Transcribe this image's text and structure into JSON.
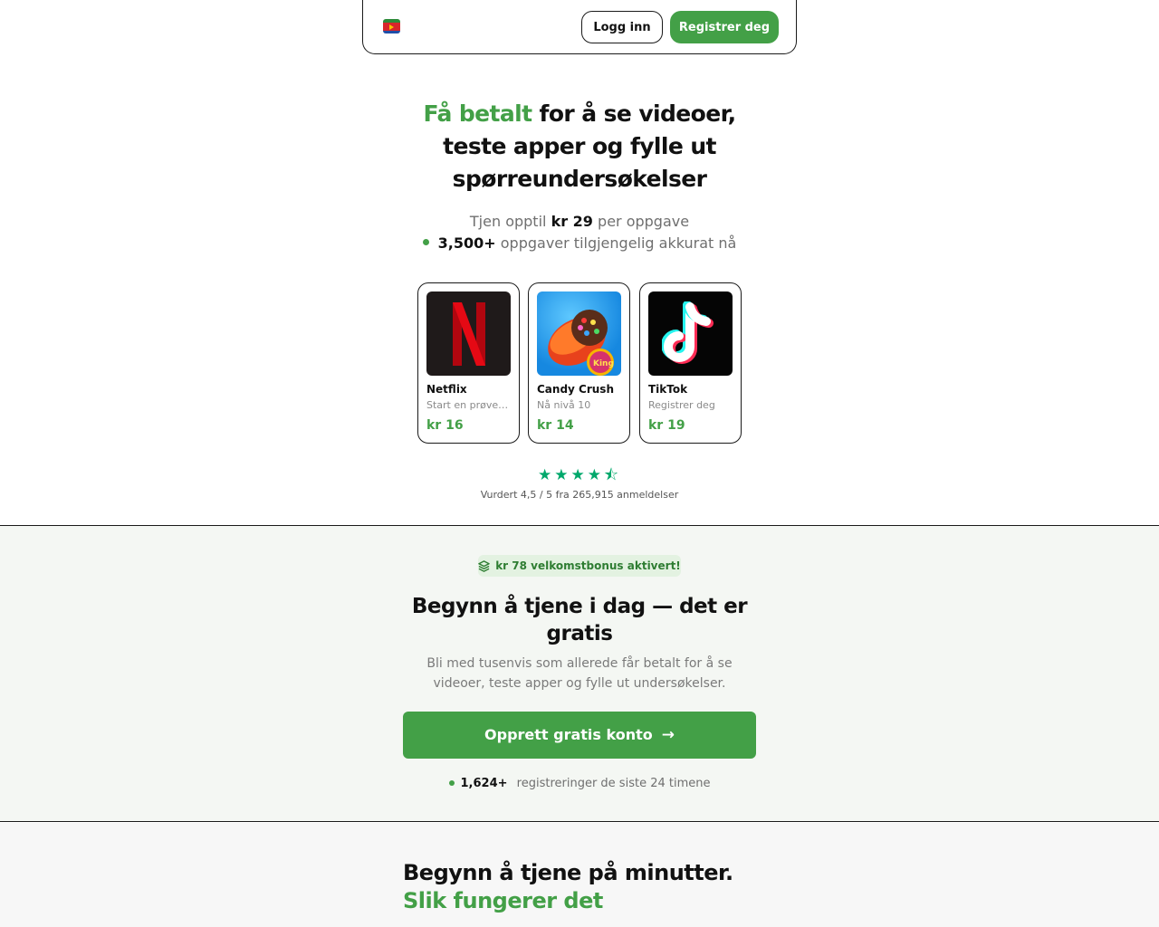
{
  "header": {
    "login_label": "Logg inn",
    "register_label": "Registrer deg"
  },
  "hero": {
    "title_highlight": "Få betalt",
    "title_rest": "for å se videoer, teste apper og fylle ut spørreundersøkelser",
    "earn_prefix": "Tjen opptil",
    "earn_amount": "kr 29",
    "earn_suffix": "per oppgave",
    "tasks_count": "3,500+",
    "tasks_suffix": "oppgaver tilgjengelig akkurat nå"
  },
  "tasks": [
    {
      "name": "Netflix",
      "desc": "Start en prøveperiode",
      "price": "kr 16",
      "icon": "netflix-logo"
    },
    {
      "name": "Candy Crush",
      "desc": "Nå nivå 10",
      "price": "kr 14",
      "icon": "candy-crush-logo"
    },
    {
      "name": "TikTok",
      "desc": "Registrer deg",
      "price": "kr 19",
      "icon": "tiktok-logo"
    }
  ],
  "rating": {
    "stars": "★★★★⯪",
    "value": 4.5,
    "text": "Vurdert 4,5 / 5 fra 265,915 anmeldelser"
  },
  "signup_section": {
    "bonus": "kr 78 velkomstbonus aktivert!",
    "title": "Begynn å tjene i dag — det er gratis",
    "description": "Bli med tusenvis som allerede får betalt for å se videoer, teste apper og fylle ut undersøkelser.",
    "cta_label": "Opprett gratis konto",
    "signups_count": "1,624+",
    "signups_suffix": "registreringer de siste 24 timene"
  },
  "how_section": {
    "title": "Begynn å tjene på minutter.",
    "subtitle": "Slik fungerer det"
  },
  "colors": {
    "accent": "#43a047",
    "star": "#00a86b",
    "section_bg": "#f4f7f3"
  }
}
